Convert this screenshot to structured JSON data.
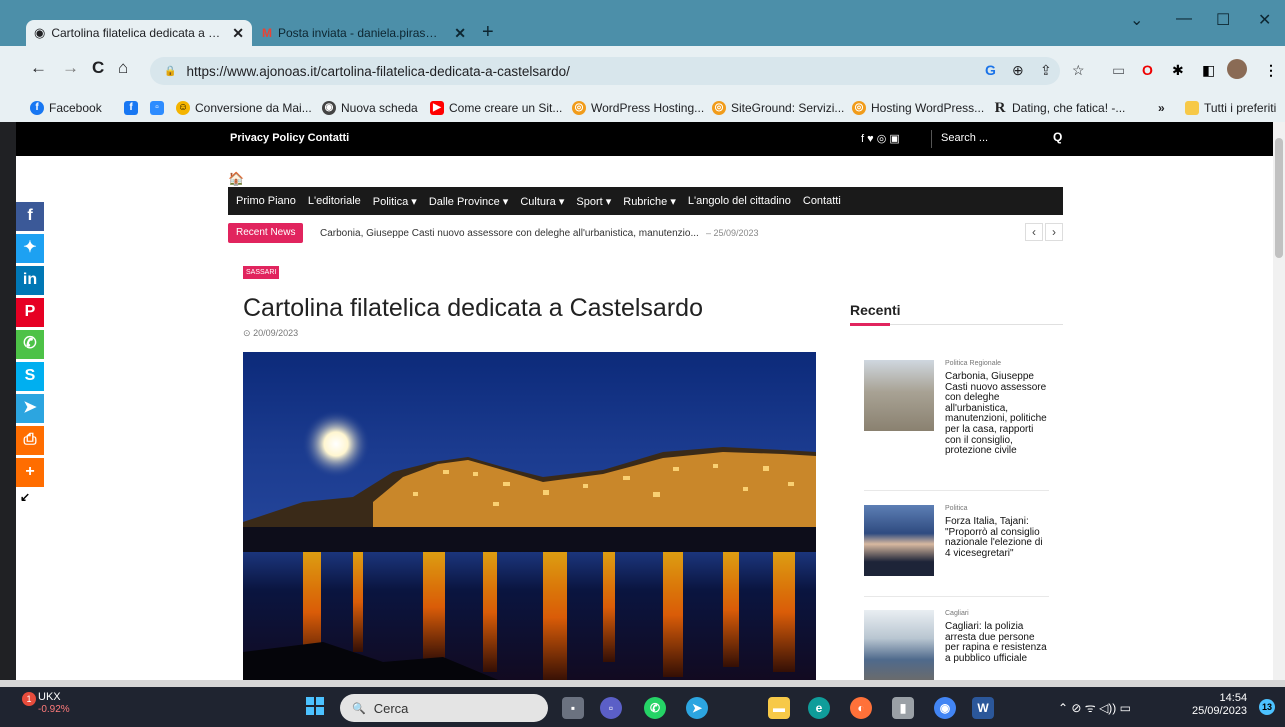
{
  "browser": {
    "tabs": [
      {
        "title": "Cartolina filatelica dedicata a Cas",
        "active": true
      },
      {
        "title": "Posta inviata - daniela.piras@gm",
        "active": false
      }
    ],
    "close_glyph": "✕",
    "new_tab_glyph": "+",
    "window_controls": {
      "dropdown": "⌄",
      "minimize": "—",
      "maximize": "☐",
      "close": "✕"
    },
    "url": "https://www.ajonoas.it/cartolina-filatelica-dedicata-a-castelsardo/",
    "nav": {
      "back": "←",
      "forward": "→",
      "reload": "C",
      "home": "⌂",
      "lock": "🔒"
    },
    "omnibox_icons": {
      "google": "G",
      "zoom": "⊕",
      "share": "⇪",
      "star": "☆"
    },
    "bookmarks": [
      {
        "label": "Facebook",
        "icon": "facebook-icon",
        "color": "#1877f2",
        "glyph": "f"
      },
      {
        "label": "",
        "icon": "facebook-square-icon",
        "color": "#1877f2",
        "glyph": "f"
      },
      {
        "label": "",
        "icon": "zoom-icon",
        "color": "#2d8cff",
        "glyph": "▫"
      },
      {
        "label": "Conversione da Mai...",
        "icon": "paw-icon",
        "color": "#f4b400",
        "glyph": "☺"
      },
      {
        "label": "Nuova scheda",
        "icon": "chrome-icon",
        "color": "#444",
        "glyph": "◉"
      },
      {
        "label": "Come creare un Sit...",
        "icon": "youtube-icon",
        "color": "#ff0000",
        "glyph": "▶"
      },
      {
        "label": "WordPress Hosting...",
        "icon": "siteground-icon",
        "color": "#f19c1b",
        "glyph": "◎"
      },
      {
        "label": "SiteGround: Servizi...",
        "icon": "siteground-icon",
        "color": "#f19c1b",
        "glyph": "◎"
      },
      {
        "label": "Hosting WordPress...",
        "icon": "siteground-icon",
        "color": "#f19c1b",
        "glyph": "◎"
      },
      {
        "label": "Dating, che fatica! -...",
        "icon": "r-icon",
        "color": "#333",
        "glyph": "R"
      }
    ],
    "bookmarks_more": "»",
    "bookmarks_folder": "Tutti i preferiti"
  },
  "site": {
    "topbar_links": "Privacy Policy  Contatti",
    "social_glyphs": "f  ♥  ◎  ▣",
    "search_placeholder": "Search ...",
    "search_icon": "Q",
    "home_glyph": "🏠",
    "menu": [
      "Primo Piano",
      "L'editoriale",
      "Politica ▾",
      "Dalle Province ▾",
      "Cultura ▾",
      "Sport ▾",
      "Rubriche ▾",
      "L'angolo del cittadino",
      "Contatti"
    ],
    "recent_label": "Recent News",
    "recent_headline": "Carbonia, Giuseppe Casti nuovo assessore con deleghe all'urbanistica, manutenzio...",
    "recent_date": "–  25/09/2023",
    "arrow_prev": "‹",
    "arrow_next": "›",
    "share_buttons": [
      {
        "name": "facebook",
        "glyph": "f",
        "color": "#3b5998"
      },
      {
        "name": "twitter",
        "glyph": "✦",
        "color": "#1da1f2"
      },
      {
        "name": "linkedin",
        "glyph": "in",
        "color": "#0077b5"
      },
      {
        "name": "pinterest",
        "glyph": "P",
        "color": "#e60023"
      },
      {
        "name": "whatsapp",
        "glyph": "✆",
        "color": "#4dc247"
      },
      {
        "name": "skype",
        "glyph": "S",
        "color": "#00aff0"
      },
      {
        "name": "telegram",
        "glyph": "➤",
        "color": "#2ca5e0"
      },
      {
        "name": "print",
        "glyph": "⎙",
        "color": "#ff6d00"
      },
      {
        "name": "more",
        "glyph": "+",
        "color": "#ff6d00"
      }
    ],
    "share_collapse": "↙"
  },
  "article": {
    "category": "SASSARI",
    "title": "Cartolina filatelica dedicata a Castelsardo",
    "date": "20/09/2023",
    "clock_glyph": "⊙"
  },
  "sidebar": {
    "title": "Recenti",
    "items": [
      {
        "category": "Politica Regionale",
        "title": "Carbonia, Giuseppe Casti nuovo assessore con deleghe all'urbanistica, manutenzioni, politiche per la casa, rapporti con il consiglio, protezione civile"
      },
      {
        "category": "Politica",
        "title": "Forza Italia, Tajani: \"Proporrò al consiglio nazionale l'elezione di 4 vicesegretari\""
      },
      {
        "category": "Cagliari",
        "title": "Cagliari: la polizia arresta due persone per rapina e resistenza a pubblico ufficiale"
      }
    ]
  },
  "taskbar": {
    "stock_symbol": "UKX",
    "stock_change": "-0.92%",
    "stock_badge": "1",
    "search_label": "Cerca",
    "search_glyph": "🔍",
    "time": "14:54",
    "date": "25/09/2023",
    "notifications": "13",
    "tray": "⌃  ⊘  ᯤ  ◁))  ▭"
  }
}
